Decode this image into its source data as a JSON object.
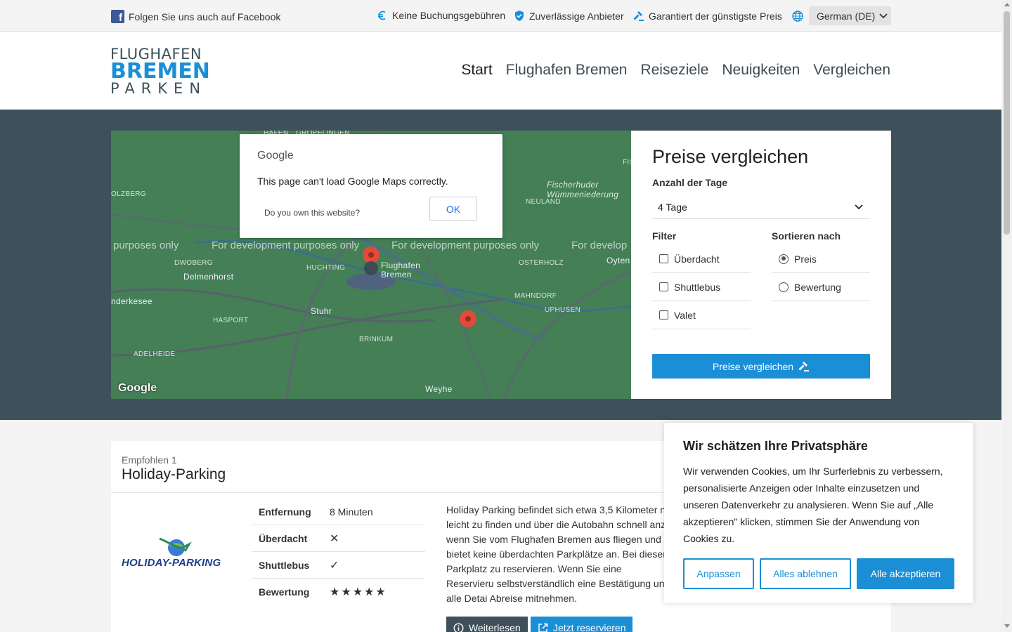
{
  "topbar": {
    "facebook": "Folgen Sie uns auch auf Facebook",
    "usp": [
      "Keine Buchungsgebühren",
      "Zuverlässige Anbieter",
      "Garantiert der günstigste Preis"
    ],
    "language": "German (DE)"
  },
  "logo": {
    "line1": "FLUGHAFEN",
    "line2": "BREMEN",
    "line3": "PARKEN"
  },
  "nav": [
    "Start",
    "Flughafen Bremen",
    "Reiseziele",
    "Neuigkeiten",
    "Vergleichen"
  ],
  "map": {
    "dialog": {
      "brand": "Google",
      "message": "This page can't load Google Maps correctly.",
      "own": "Do you own this website?",
      "ok": "OK"
    },
    "dev_text": "For development purposes only",
    "dev_text_short": "purposes only",
    "dev_text_cut": "For develop",
    "places": [
      "Fischerhuder Wümmeniederung",
      "Flughafen Bremen",
      "Delmenhorst",
      "Stuhr",
      "Weyhe",
      "DWOBERG",
      "HUCHTING",
      "HASPORT",
      "ADELHEIDE",
      "BRINKUM",
      "OSTERHOLZ",
      "MAHNDORF",
      "UPHUSEN",
      "Oyten",
      "OLZBERG",
      "nderkesee",
      "NEULAND",
      "GRÖPELINGEN",
      "HÄFEN",
      "FIS"
    ],
    "google": "Google"
  },
  "panel": {
    "title": "Preise vergleichen",
    "days_label": "Anzahl der Tage",
    "days_value": "4 Tage",
    "filter_label": "Filter",
    "filters": [
      "Überdacht",
      "Shuttlebus",
      "Valet"
    ],
    "sort_label": "Sortieren nach",
    "sort": [
      "Preis",
      "Bewertung"
    ],
    "button": "Preise vergleichen"
  },
  "listing": {
    "recommended": "Empfohlen 1",
    "name": "Holiday-Parking",
    "logo_text": "HOLIDAY-PARKING",
    "rows": [
      {
        "k": "Entfernung",
        "v": "8 Minuten"
      },
      {
        "k": "Überdacht",
        "v": "✕"
      },
      {
        "k": "Shuttlebus",
        "v": "✓"
      },
      {
        "k": "Bewertung",
        "v": "★★★★★"
      }
    ],
    "description": "Holiday Parking befindet sich etwa 3,5 Kilometer n leicht zu finden und über die Autobahn schnell anz wenn Sie vom Flughafen Bremen aus fliegen und a bietet keine überdachten Parkplätze an. Bei diesen Parkplatz zu reservieren. Wenn Sie eine Reservieru selbstverständlich eine Bestätigung und alle Detai Abreise mitnehmen.",
    "more": "Weiterlesen",
    "reserve": "Jetzt reservieren"
  },
  "cookie": {
    "title": "Wir schätzen Ihre Privatsphäre",
    "text": "Wir verwenden Cookies, um Ihr Surferlebnis zu verbessern, personalisierte Anzeigen oder Inhalte einzusetzen und unseren Datenverkehr zu analysieren. Wenn Sie auf „Alle akzeptieren\" klicken, stimmen Sie der Anwendung von Cookies zu.",
    "customize": "Anpassen",
    "reject": "Alles ablehnen",
    "accept": "Alle akzeptieren"
  },
  "colors": {
    "accent": "#1b8fd6",
    "hero_bg": "#3e5059",
    "map_green": "#3f7a52",
    "dark_btn": "#3e5059"
  }
}
